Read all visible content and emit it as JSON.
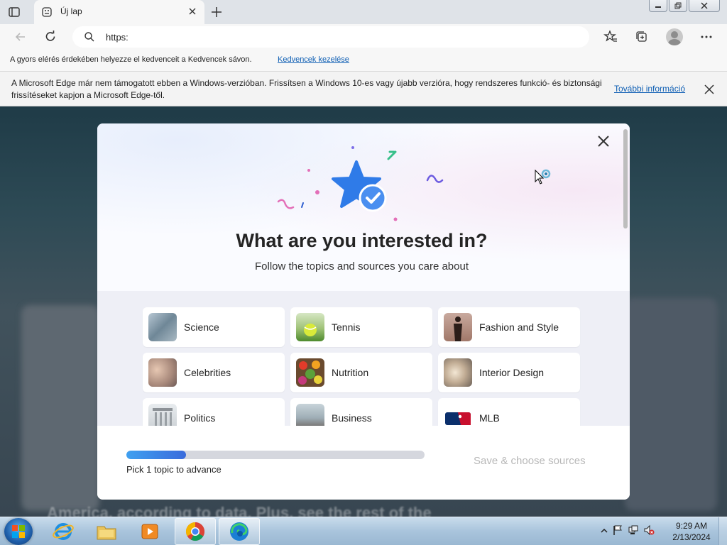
{
  "browser": {
    "tab": {
      "title": "Új lap"
    },
    "address": {
      "value": "https:"
    },
    "favorites_bar": {
      "message": "A gyors elérés érdekében helyezze el kedvenceit a Kedvencek sávon.",
      "link": "Kedvencek kezelése"
    },
    "info_bar": {
      "message": "A Microsoft Edge már nem támogatott ebben a Windows-verzióban. Frissítsen a Windows 10-es vagy újabb verzióra, hogy rendszeres funkció- és biztonsági frissítéseket kapjon a Microsoft Edge-től.",
      "link": "További információ"
    }
  },
  "page_background": {
    "blurred_text": "America, according to data. Plus, see the rest of the"
  },
  "modal": {
    "title": "What are you interested in?",
    "subtitle": "Follow the topics and sources you care about",
    "topics": [
      {
        "label": "Science",
        "icon": "science-thumbnail"
      },
      {
        "label": "Tennis",
        "icon": "tennis-thumbnail"
      },
      {
        "label": "Fashion and Style",
        "icon": "fashion-thumbnail"
      },
      {
        "label": "Celebrities",
        "icon": "celebrities-thumbnail"
      },
      {
        "label": "Nutrition",
        "icon": "nutrition-thumbnail"
      },
      {
        "label": "Interior Design",
        "icon": "interior-design-thumbnail"
      },
      {
        "label": "Politics",
        "icon": "politics-thumbnail"
      },
      {
        "label": "Business",
        "icon": "business-thumbnail"
      },
      {
        "label": "MLB",
        "icon": "mlb-logo"
      }
    ],
    "progress": {
      "fraction": 0.2,
      "text": "Pick 1 topic to advance"
    },
    "save_button": "Save & choose sources"
  },
  "taskbar": {
    "clock": {
      "time": "9:29 AM",
      "date": "2/13/2024"
    }
  },
  "colors": {
    "accent": "#3a6bdc",
    "link": "#0f5fb4",
    "disabled_text": "#b8b8b8"
  }
}
